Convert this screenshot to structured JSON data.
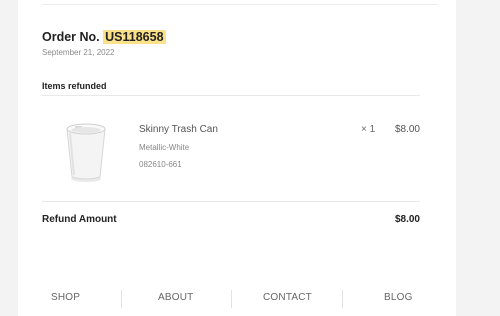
{
  "order": {
    "label": "Order No.",
    "number": "US118658",
    "date": "September 21, 2022"
  },
  "section_title": "Items refunded",
  "item": {
    "name": "Skinny Trash Can",
    "variant": "Metallic-White",
    "sku": "082610-661",
    "qty": "× 1",
    "price": "$8.00",
    "image_icon": "trash-can-product-image"
  },
  "refund": {
    "label": "Refund Amount",
    "value": "$8.00"
  },
  "footer": {
    "links": [
      "SHOP",
      "ABOUT",
      "CONTACT",
      "BLOG"
    ]
  },
  "colors": {
    "highlight": "#fbe18a",
    "background": "#f3f3f3",
    "card": "#ffffff"
  }
}
